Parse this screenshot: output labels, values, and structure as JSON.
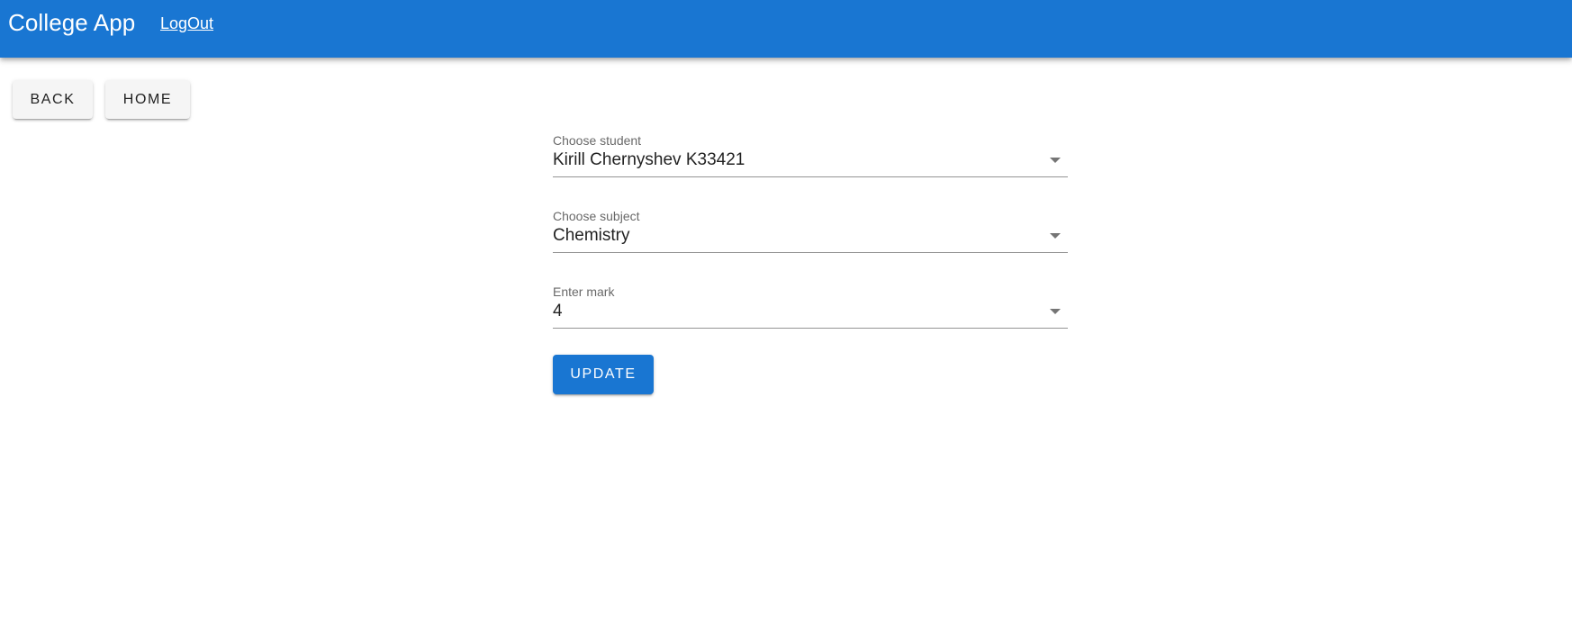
{
  "header": {
    "title": "College App",
    "logout_label": "LogOut"
  },
  "nav": {
    "back_label": "BACK",
    "home_label": "HOME"
  },
  "form": {
    "student": {
      "label": "Choose student",
      "value": "Kirill Chernyshev K33421"
    },
    "subject": {
      "label": "Choose subject",
      "value": "Chemistry"
    },
    "mark": {
      "label": "Enter mark",
      "value": "4"
    },
    "update_label": "UPDATE"
  },
  "colors": {
    "primary": "#1976d2",
    "secondary_button": "#f5f5f5"
  }
}
